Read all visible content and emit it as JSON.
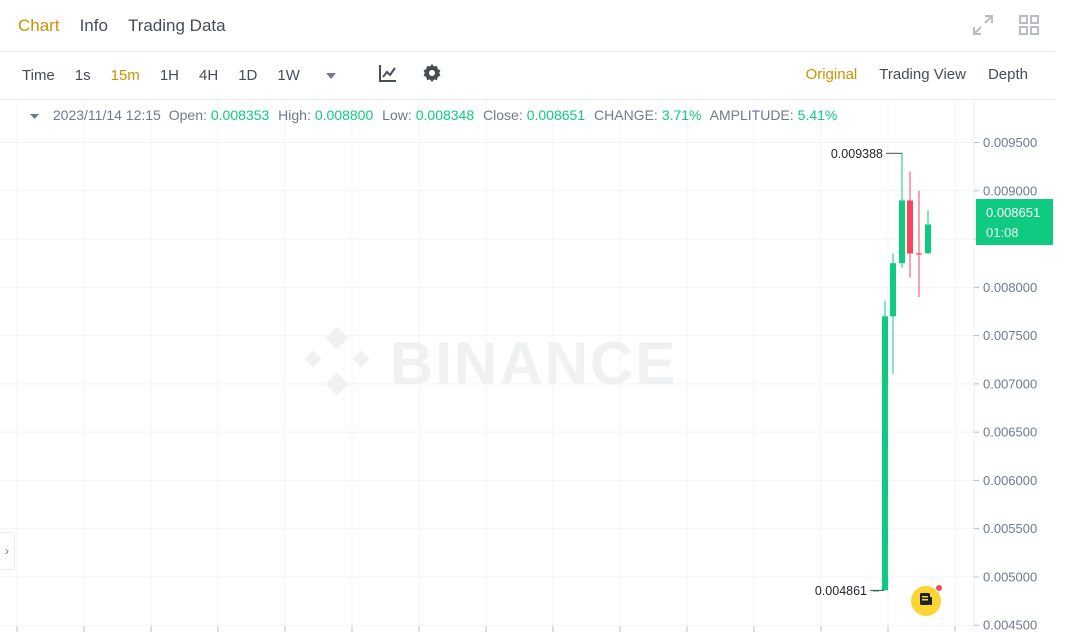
{
  "header": {
    "tabs": [
      {
        "label": "Chart",
        "active": true
      },
      {
        "label": "Info",
        "active": false
      },
      {
        "label": "Trading Data",
        "active": false
      }
    ]
  },
  "toolbar": {
    "intervals": [
      {
        "label": "Time",
        "active": false
      },
      {
        "label": "1s",
        "active": false
      },
      {
        "label": "15m",
        "active": true
      },
      {
        "label": "1H",
        "active": false
      },
      {
        "label": "4H",
        "active": false
      },
      {
        "label": "1D",
        "active": false
      },
      {
        "label": "1W",
        "active": false
      }
    ],
    "views": [
      {
        "label": "Original",
        "active": true
      },
      {
        "label": "Trading View",
        "active": false
      },
      {
        "label": "Depth",
        "active": false
      }
    ]
  },
  "info": {
    "datetime": "2023/11/14 12:15",
    "open_label": "Open:",
    "open": "0.008353",
    "high_label": "High:",
    "high": "0.008800",
    "low_label": "Low:",
    "low": "0.008348",
    "close_label": "Close:",
    "close": "0.008651",
    "change_label": "CHANGE:",
    "change": "3.71%",
    "amplitude_label": "AMPLITUDE:",
    "amplitude": "5.41%"
  },
  "watermark": "BINANCE",
  "price_tag": {
    "price": "0.008651",
    "countdown": "01:08"
  },
  "colors": {
    "accent": "#c99400",
    "up": "#0ecb81",
    "down": "#f6465d",
    "grid": "#f2f3f5"
  },
  "chart_data": {
    "type": "candlestick",
    "yticks": [
      "0.009500",
      "0.009000",
      "0.008500",
      "0.008000",
      "0.007500",
      "0.007000",
      "0.006500",
      "0.006000",
      "0.005500",
      "0.005000",
      "0.004500"
    ],
    "ylim": [
      0.00443,
      0.00993
    ],
    "high_marker": "0.009388",
    "low_marker": "0.004861",
    "candles": [
      {
        "open": 0.004861,
        "high": 0.004861,
        "low": 0.004861,
        "close": 0.004861
      },
      {
        "open": 0.004861,
        "high": 0.00786,
        "low": 0.004861,
        "close": 0.0077
      },
      {
        "open": 0.0077,
        "high": 0.00835,
        "low": 0.0071,
        "close": 0.00825
      },
      {
        "open": 0.00825,
        "high": 0.009388,
        "low": 0.0082,
        "close": 0.0089
      },
      {
        "open": 0.0089,
        "high": 0.0092,
        "low": 0.0081,
        "close": 0.00835
      },
      {
        "open": 0.008353,
        "high": 0.009,
        "low": 0.0079,
        "close": 0.00835
      },
      {
        "open": 0.008353,
        "high": 0.0088,
        "low": 0.008348,
        "close": 0.008651
      }
    ]
  }
}
